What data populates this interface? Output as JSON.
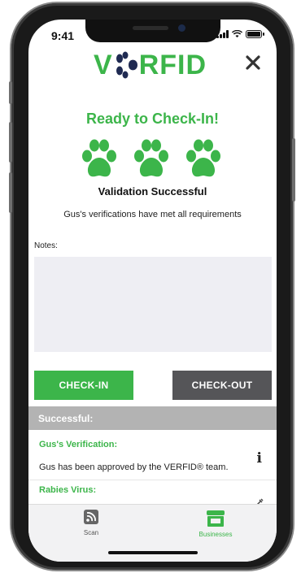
{
  "status_bar": {
    "time": "9:41"
  },
  "header": {
    "logo_text_left": "V",
    "logo_text_right": "RFID",
    "close_icon": "close-icon"
  },
  "main": {
    "title": "Ready to Check-In!",
    "validation": "Validation Successful",
    "requirements": "Gus's verifications have met all requirements",
    "notes_label": "Notes:",
    "notes_value": ""
  },
  "actions": {
    "check_in": "CHECK-IN",
    "check_out": "CHECK-OUT"
  },
  "results": {
    "section_title": "Successful:",
    "items": [
      {
        "title": "Gus's Verification:",
        "description": "Gus has been approved by the VERFID® team.",
        "icon": "info-icon"
      },
      {
        "title": "Rabies Virus:",
        "description": "",
        "icon": "syringe-icon"
      }
    ]
  },
  "tabbar": {
    "tabs": [
      {
        "label": "Scan",
        "icon": "scan-icon"
      },
      {
        "label": "Businesses",
        "icon": "storefront-icon"
      }
    ]
  },
  "colors": {
    "brand_green": "#3cb54a",
    "paw_navy": "#1f2a52",
    "dark_button": "#555558",
    "section_gray": "#b3b3b3"
  }
}
